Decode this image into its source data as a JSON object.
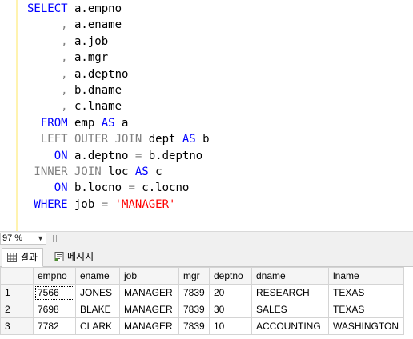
{
  "editor": {
    "lines": [
      [
        {
          "t": "SELECT",
          "c": "k"
        },
        {
          "t": " a.empno",
          "c": "p"
        }
      ],
      [
        {
          "t": "     ,",
          "c": "g"
        },
        {
          "t": " a.ename",
          "c": "p"
        }
      ],
      [
        {
          "t": "     ,",
          "c": "g"
        },
        {
          "t": " a.job",
          "c": "p"
        }
      ],
      [
        {
          "t": "     ,",
          "c": "g"
        },
        {
          "t": " a.mgr",
          "c": "p"
        }
      ],
      [
        {
          "t": "     ,",
          "c": "g"
        },
        {
          "t": " a.deptno",
          "c": "p"
        }
      ],
      [
        {
          "t": "     ,",
          "c": "g"
        },
        {
          "t": " b.dname",
          "c": "p"
        }
      ],
      [
        {
          "t": "     ,",
          "c": "g"
        },
        {
          "t": " c.lname",
          "c": "p"
        }
      ],
      [
        {
          "t": "  FROM",
          "c": "k"
        },
        {
          "t": " emp ",
          "c": "p"
        },
        {
          "t": "AS",
          "c": "k"
        },
        {
          "t": " a",
          "c": "p"
        }
      ],
      [
        {
          "t": "  LEFT OUTER JOIN",
          "c": "g"
        },
        {
          "t": " dept ",
          "c": "p"
        },
        {
          "t": "AS",
          "c": "k"
        },
        {
          "t": " b",
          "c": "p"
        }
      ],
      [
        {
          "t": "    ON",
          "c": "k"
        },
        {
          "t": " a.deptno ",
          "c": "p"
        },
        {
          "t": "=",
          "c": "g"
        },
        {
          "t": " b.deptno",
          "c": "p"
        }
      ],
      [
        {
          "t": " INNER JOIN",
          "c": "g"
        },
        {
          "t": " loc ",
          "c": "p"
        },
        {
          "t": "AS",
          "c": "k"
        },
        {
          "t": " c",
          "c": "p"
        }
      ],
      [
        {
          "t": "    ON",
          "c": "k"
        },
        {
          "t": " b.locno ",
          "c": "p"
        },
        {
          "t": "=",
          "c": "g"
        },
        {
          "t": " c.locno",
          "c": "p"
        }
      ],
      [
        {
          "t": " WHERE",
          "c": "k"
        },
        {
          "t": " job ",
          "c": "p"
        },
        {
          "t": "=",
          "c": "g"
        },
        {
          "t": " ",
          "c": "p"
        },
        {
          "t": "'MANAGER'",
          "c": "s"
        }
      ]
    ]
  },
  "status": {
    "zoom": "97 %"
  },
  "tabs": {
    "results": "결과",
    "messages": "메시지"
  },
  "grid": {
    "columns": [
      "empno",
      "ename",
      "job",
      "mgr",
      "deptno",
      "dname",
      "lname"
    ],
    "rows": [
      {
        "n": "1",
        "cells": [
          "7566",
          "JONES",
          "MANAGER",
          "7839",
          "20",
          "RESEARCH",
          "TEXAS"
        ]
      },
      {
        "n": "2",
        "cells": [
          "7698",
          "BLAKE",
          "MANAGER",
          "7839",
          "30",
          "SALES",
          "TEXAS"
        ]
      },
      {
        "n": "3",
        "cells": [
          "7782",
          "CLARK",
          "MANAGER",
          "7839",
          "10",
          "ACCOUNTING",
          "WASHINGTON"
        ]
      }
    ]
  },
  "colors": {
    "keyword": "#0000ff",
    "operator": "#808080",
    "string": "#ff0000"
  }
}
